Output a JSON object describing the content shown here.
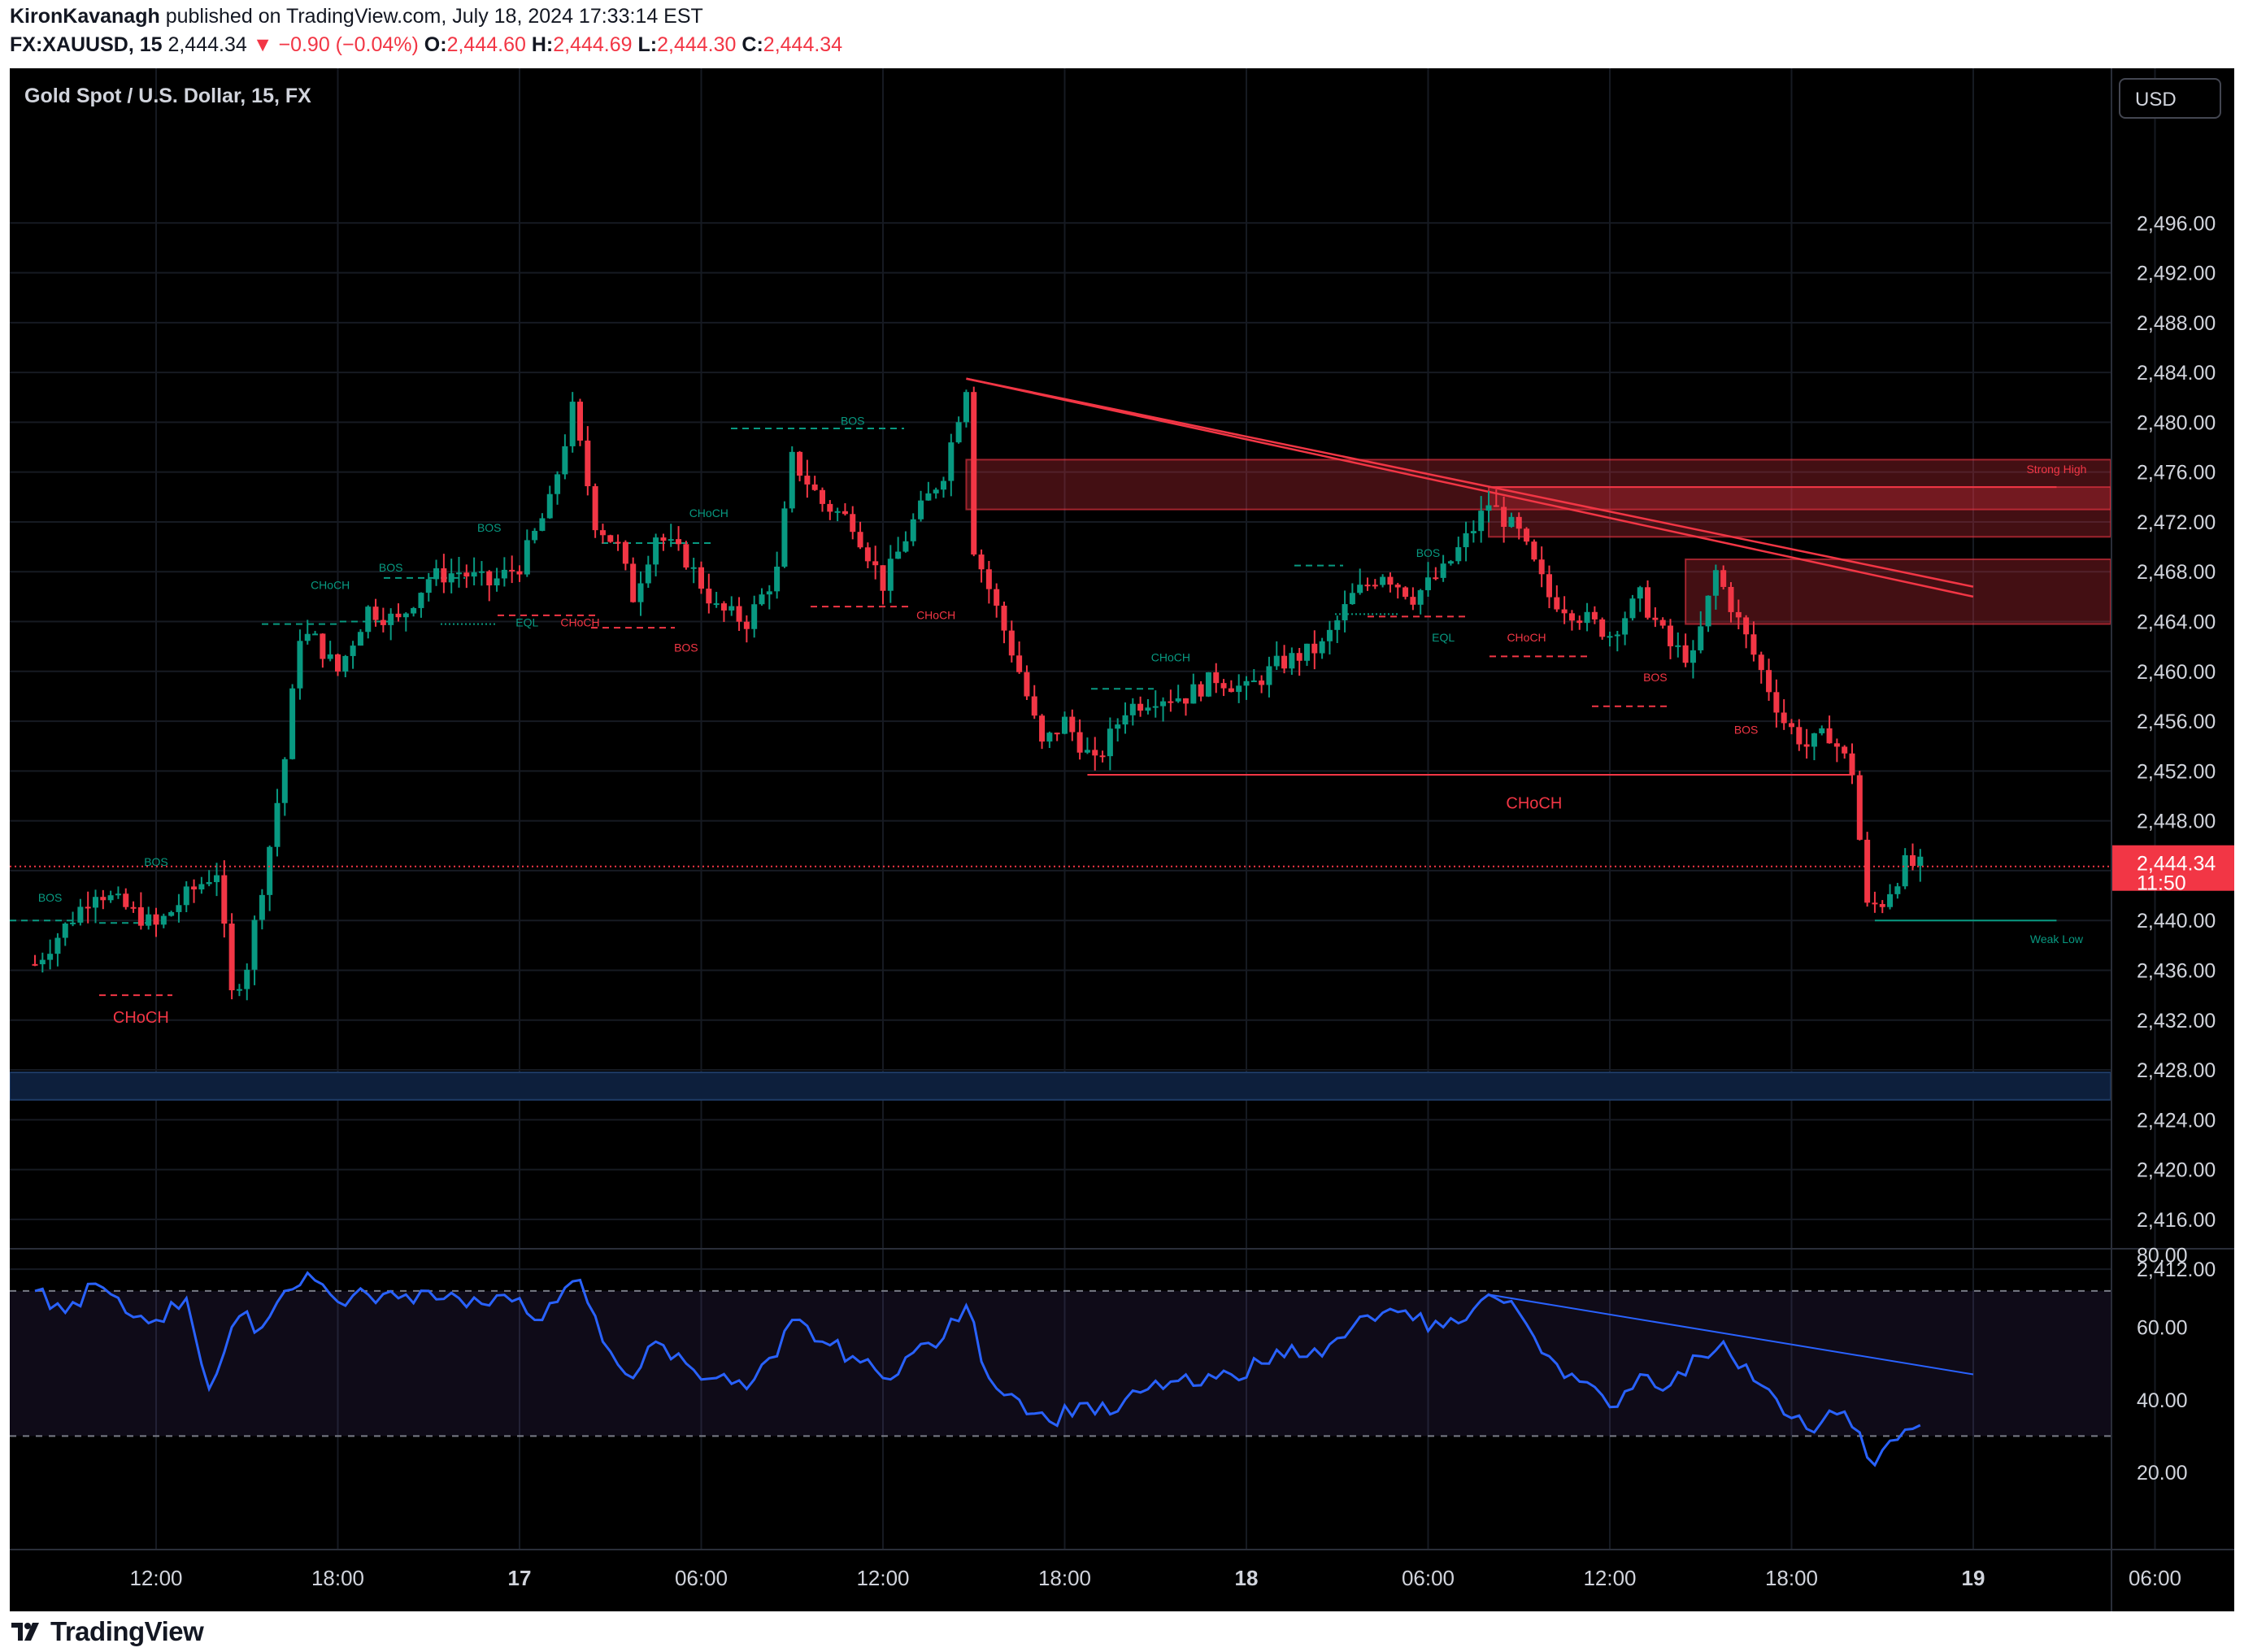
{
  "header": {
    "author": "KironKavanagh",
    "published_text": " published on TradingView.com, July 18, 2024 17:33:14 EST",
    "symbol_interval": "FX:XAUUSD, 15",
    "last_price": "2,444.34",
    "change_arrow": "▼",
    "change": "−0.90 (−0.04%)",
    "open_label": "O:",
    "open": "2,444.60",
    "high_label": "H:",
    "high": "2,444.69",
    "low_label": "L:",
    "low": "2,444.30",
    "close_label": "C:",
    "close": "2,444.34"
  },
  "chart": {
    "symbol_title": "Gold Spot / U.S. Dollar, 15, FX",
    "currency_button": "USD",
    "price_tag": "2,444.34",
    "countdown": "11:50"
  },
  "colors": {
    "up": "#089981",
    "down": "#f23645",
    "rsi_line": "#2962ff",
    "background": "#000000",
    "text": "#d1d4dc",
    "zone_red": "#f23645",
    "zone_blue": "#1e3a64",
    "rsi_band": "#7e57c2"
  },
  "footer": {
    "brand": "TradingView",
    "logo_icon": "tradingview-logo-icon"
  },
  "chart_data": [
    {
      "type": "candlestick",
      "title": "Gold Spot / U.S. Dollar, 15, FX",
      "x_tick_labels": [
        "12:00",
        "18:00",
        "17",
        "06:00",
        "12:00",
        "18:00",
        "18",
        "06:00",
        "12:00",
        "18:00",
        "19",
        "06:00"
      ],
      "y_tick_labels": [
        "2,412.00",
        "2,416.00",
        "2,420.00",
        "2,424.00",
        "2,428.00",
        "2,432.00",
        "2,436.00",
        "2,440.00",
        "2,444.00",
        "2,448.00",
        "2,452.00",
        "2,456.00",
        "2,460.00",
        "2,464.00",
        "2,468.00",
        "2,472.00",
        "2,476.00",
        "2,480.00",
        "2,484.00",
        "2,488.00",
        "2,492.00",
        "2,496.00"
      ],
      "ylim": [
        2409,
        2500
      ],
      "grid": true,
      "last_price": 2444.34,
      "price_path": [
        {
          "t": "2024-07-16 08:00",
          "p": 2436.5
        },
        {
          "t": "2024-07-16 09:00",
          "p": 2439.5
        },
        {
          "t": "2024-07-16 10:00",
          "p": 2442.5
        },
        {
          "t": "2024-07-16 11:00",
          "p": 2441.0
        },
        {
          "t": "2024-07-16 12:00",
          "p": 2439.5
        },
        {
          "t": "2024-07-16 13:00",
          "p": 2442.0
        },
        {
          "t": "2024-07-16 14:00",
          "p": 2444.0
        },
        {
          "t": "2024-07-16 14:30",
          "p": 2434.0
        },
        {
          "t": "2024-07-16 15:00",
          "p": 2436.5
        },
        {
          "t": "2024-07-16 15:45",
          "p": 2446.0
        },
        {
          "t": "2024-07-16 16:15",
          "p": 2453.0
        },
        {
          "t": "2024-07-16 16:45",
          "p": 2463.0
        },
        {
          "t": "2024-07-16 17:15",
          "p": 2462.5
        },
        {
          "t": "2024-07-16 18:00",
          "p": 2460.0
        },
        {
          "t": "2024-07-16 19:00",
          "p": 2465.0
        },
        {
          "t": "2024-07-16 20:00",
          "p": 2464.0
        },
        {
          "t": "2024-07-16 21:00",
          "p": 2467.5
        },
        {
          "t": "2024-07-16 22:00",
          "p": 2468.0
        },
        {
          "t": "2024-07-16 23:00",
          "p": 2467.0
        },
        {
          "t": "2024-07-17 00:00",
          "p": 2468.5
        },
        {
          "t": "2024-07-17 01:00",
          "p": 2473.5
        },
        {
          "t": "2024-07-17 01:45",
          "p": 2481.0
        },
        {
          "t": "2024-07-17 02:30",
          "p": 2472.0
        },
        {
          "t": "2024-07-17 03:15",
          "p": 2470.0
        },
        {
          "t": "2024-07-17 03:45",
          "p": 2466.0
        },
        {
          "t": "2024-07-17 04:30",
          "p": 2471.0
        },
        {
          "t": "2024-07-17 05:30",
          "p": 2469.0
        },
        {
          "t": "2024-07-17 06:30",
          "p": 2465.0
        },
        {
          "t": "2024-07-17 07:30",
          "p": 2464.0
        },
        {
          "t": "2024-07-17 08:30",
          "p": 2468.0
        },
        {
          "t": "2024-07-17 09:00",
          "p": 2477.0
        },
        {
          "t": "2024-07-17 10:00",
          "p": 2473.5
        },
        {
          "t": "2024-07-17 11:00",
          "p": 2472.0
        },
        {
          "t": "2024-07-17 12:00",
          "p": 2467.0
        },
        {
          "t": "2024-07-17 13:00",
          "p": 2472.0
        },
        {
          "t": "2024-07-17 14:00",
          "p": 2476.0
        },
        {
          "t": "2024-07-17 14:45",
          "p": 2483.0
        },
        {
          "t": "2024-07-17 15:00",
          "p": 2470.0
        },
        {
          "t": "2024-07-17 15:45",
          "p": 2465.0
        },
        {
          "t": "2024-07-17 16:30",
          "p": 2460.0
        },
        {
          "t": "2024-07-17 17:15",
          "p": 2454.0
        },
        {
          "t": "2024-07-17 18:00",
          "p": 2456.0
        },
        {
          "t": "2024-07-17 19:00",
          "p": 2452.5
        },
        {
          "t": "2024-07-17 20:00",
          "p": 2457.0
        },
        {
          "t": "2024-07-17 21:00",
          "p": 2458.0
        },
        {
          "t": "2024-07-17 22:00",
          "p": 2458.0
        },
        {
          "t": "2024-07-17 23:00",
          "p": 2459.5
        },
        {
          "t": "2024-07-18 00:00",
          "p": 2458.5
        },
        {
          "t": "2024-07-18 01:00",
          "p": 2460.5
        },
        {
          "t": "2024-07-18 02:30",
          "p": 2462.0
        },
        {
          "t": "2024-07-18 03:30",
          "p": 2466.0
        },
        {
          "t": "2024-07-18 04:30",
          "p": 2468.0
        },
        {
          "t": "2024-07-18 05:30",
          "p": 2466.0
        },
        {
          "t": "2024-07-18 06:30",
          "p": 2468.0
        },
        {
          "t": "2024-07-18 07:30",
          "p": 2471.5
        },
        {
          "t": "2024-07-18 08:00",
          "p": 2473.5
        },
        {
          "t": "2024-07-18 09:00",
          "p": 2471.0
        },
        {
          "t": "2024-07-18 10:00",
          "p": 2466.0
        },
        {
          "t": "2024-07-18 11:00",
          "p": 2464.5
        },
        {
          "t": "2024-07-18 12:00",
          "p": 2463.0
        },
        {
          "t": "2024-07-18 13:00",
          "p": 2466.0
        },
        {
          "t": "2024-07-18 14:00",
          "p": 2462.0
        },
        {
          "t": "2024-07-18 14:45",
          "p": 2461.0
        },
        {
          "t": "2024-07-18 15:30",
          "p": 2468.0
        },
        {
          "t": "2024-07-18 16:15",
          "p": 2464.0
        },
        {
          "t": "2024-07-18 17:00",
          "p": 2460.0
        },
        {
          "t": "2024-07-18 17:45",
          "p": 2456.0
        },
        {
          "t": "2024-07-18 18:30",
          "p": 2454.0
        },
        {
          "t": "2024-07-18 19:15",
          "p": 2455.0
        },
        {
          "t": "2024-07-18 20:00",
          "p": 2452.0
        },
        {
          "t": "2024-07-18 20:30",
          "p": 2441.0
        },
        {
          "t": "2024-07-18 21:00",
          "p": 2441.5
        },
        {
          "t": "2024-07-18 21:45",
          "p": 2444.5
        },
        {
          "t": "2024-07-18 22:15",
          "p": 2444.34
        }
      ],
      "annotations": [
        {
          "text": "BOS",
          "color": "#089981",
          "t": "2024-07-16 08:30",
          "p": 2441.5
        },
        {
          "text": "BOS",
          "color": "#089981",
          "t": "2024-07-16 12:00",
          "p": 2444.4
        },
        {
          "text": "CHoCH",
          "color": "#f23645",
          "t": "2024-07-16 11:30",
          "p": 2431.8
        },
        {
          "text": "CHoCH",
          "color": "#089981",
          "t": "2024-07-16 17:45",
          "p": 2466.6
        },
        {
          "text": "BOS",
          "color": "#089981",
          "t": "2024-07-16 19:45",
          "p": 2468.0
        },
        {
          "text": "BOS",
          "color": "#089981",
          "t": "2024-07-16 23:00",
          "p": 2471.2
        },
        {
          "text": "EQL",
          "color": "#089981",
          "t": "2024-07-17 00:15",
          "p": 2463.6
        },
        {
          "text": "CHoCH",
          "color": "#f23645",
          "t": "2024-07-17 02:00",
          "p": 2463.6
        },
        {
          "text": "BOS",
          "color": "#f23645",
          "t": "2024-07-17 05:30",
          "p": 2461.6
        },
        {
          "text": "CHoCH",
          "color": "#089981",
          "t": "2024-07-17 06:15",
          "p": 2472.4
        },
        {
          "text": "BOS",
          "color": "#089981",
          "t": "2024-07-17 11:00",
          "p": 2479.8
        },
        {
          "text": "CHoCH",
          "color": "#f23645",
          "t": "2024-07-17 13:45",
          "p": 2464.2
        },
        {
          "text": "CHoCH",
          "color": "#089981",
          "t": "2024-07-17 21:30",
          "p": 2460.8
        },
        {
          "text": "BOS",
          "color": "#089981",
          "t": "2024-07-18 06:00",
          "p": 2469.2
        },
        {
          "text": "EQL",
          "color": "#089981",
          "t": "2024-07-18 06:30",
          "p": 2462.4
        },
        {
          "text": "CHoCH",
          "color": "#f23645",
          "t": "2024-07-18 09:15",
          "p": 2462.4
        },
        {
          "text": "BOS",
          "color": "#f23645",
          "t": "2024-07-18 13:30",
          "p": 2459.2
        },
        {
          "text": "BOS",
          "color": "#f23645",
          "t": "2024-07-18 16:30",
          "p": 2455.0
        },
        {
          "text": "CHoCH",
          "color": "#f23645",
          "t": "2024-07-18 09:30",
          "p": 2449.0
        },
        {
          "text": "Strong High",
          "color": "#f23645",
          "t": "2024-07-19 02:45",
          "p": 2475.9
        },
        {
          "text": "Weak Low",
          "color": "#089981",
          "t": "2024-07-19 02:45",
          "p": 2438.2
        }
      ],
      "zones": [
        {
          "kind": "supply",
          "from": "2024-07-17 14:45",
          "to": "2024-07-19 10:00",
          "low": 2473.0,
          "high": 2477.0
        },
        {
          "kind": "supply",
          "from": "2024-07-18 08:00",
          "to": "2024-07-19 10:00",
          "low": 2470.8,
          "high": 2474.8
        },
        {
          "kind": "supply",
          "from": "2024-07-18 14:30",
          "to": "2024-07-19 10:00",
          "low": 2463.8,
          "high": 2469.0
        },
        {
          "kind": "demand",
          "from": "2024-07-16 08:00",
          "to": "2024-07-19 10:00",
          "low": 2425.6,
          "high": 2427.8
        }
      ],
      "trendlines": [
        {
          "from_t": "2024-07-17 14:45",
          "from_p": 2483.5,
          "to_t": "2024-07-19 00:00",
          "to_p": 2466.0
        },
        {
          "from_t": "2024-07-17 14:45",
          "from_p": 2483.5,
          "to_t": "2024-07-19 00:00",
          "to_p": 2466.8
        }
      ],
      "levels": [
        {
          "t1": "2024-07-17 18:45",
          "t2": "2024-07-18 20:00",
          "p": 2451.7,
          "color": "#f23645"
        },
        {
          "t1": "2024-07-18 20:45",
          "t2": "2024-07-19 02:45",
          "p": 2440.0,
          "color": "#089981"
        },
        {
          "t1": "2024-07-18 08:00",
          "t2": "2024-07-19 02:45",
          "p": 2474.8,
          "color": "#f23645"
        }
      ]
    },
    {
      "type": "line",
      "title": "RSI",
      "y_tick_labels": [
        "20.00",
        "40.00",
        "60.00",
        "80.00"
      ],
      "ylim": [
        16,
        88
      ],
      "band": [
        30,
        70
      ],
      "series": [
        {
          "values": [
            {
              "t": "2024-07-16 08:00",
              "v": 70
            },
            {
              "t": "2024-07-16 09:00",
              "v": 64
            },
            {
              "t": "2024-07-16 10:00",
              "v": 72
            },
            {
              "t": "2024-07-16 11:00",
              "v": 64
            },
            {
              "t": "2024-07-16 12:00",
              "v": 62
            },
            {
              "t": "2024-07-16 13:00",
              "v": 68
            },
            {
              "t": "2024-07-16 13:45",
              "v": 43
            },
            {
              "t": "2024-07-16 14:45",
              "v": 63
            },
            {
              "t": "2024-07-16 15:30",
              "v": 60
            },
            {
              "t": "2024-07-16 16:15",
              "v": 70
            },
            {
              "t": "2024-07-16 17:00",
              "v": 75
            },
            {
              "t": "2024-07-16 18:00",
              "v": 67
            },
            {
              "t": "2024-07-16 19:00",
              "v": 69
            },
            {
              "t": "2024-07-16 20:00",
              "v": 68
            },
            {
              "t": "2024-07-16 21:00",
              "v": 70
            },
            {
              "t": "2024-07-16 22:00",
              "v": 68
            },
            {
              "t": "2024-07-16 23:00",
              "v": 66
            },
            {
              "t": "2024-07-17 00:00",
              "v": 68
            },
            {
              "t": "2024-07-17 00:45",
              "v": 62
            },
            {
              "t": "2024-07-17 01:15",
              "v": 67
            },
            {
              "t": "2024-07-17 02:00",
              "v": 73
            },
            {
              "t": "2024-07-17 02:45",
              "v": 56
            },
            {
              "t": "2024-07-17 03:45",
              "v": 46
            },
            {
              "t": "2024-07-17 04:30",
              "v": 56
            },
            {
              "t": "2024-07-17 05:30",
              "v": 50
            },
            {
              "t": "2024-07-17 06:30",
              "v": 46
            },
            {
              "t": "2024-07-17 07:30",
              "v": 43
            },
            {
              "t": "2024-07-17 08:30",
              "v": 52
            },
            {
              "t": "2024-07-17 09:00",
              "v": 62
            },
            {
              "t": "2024-07-17 10:00",
              "v": 56
            },
            {
              "t": "2024-07-17 11:00",
              "v": 52
            },
            {
              "t": "2024-07-17 12:00",
              "v": 46
            },
            {
              "t": "2024-07-17 13:00",
              "v": 53
            },
            {
              "t": "2024-07-17 14:00",
              "v": 57
            },
            {
              "t": "2024-07-17 14:45",
              "v": 66
            },
            {
              "t": "2024-07-17 15:30",
              "v": 46
            },
            {
              "t": "2024-07-17 16:30",
              "v": 40
            },
            {
              "t": "2024-07-17 17:30",
              "v": 34
            },
            {
              "t": "2024-07-17 18:30",
              "v": 39
            },
            {
              "t": "2024-07-17 19:30",
              "v": 36
            },
            {
              "t": "2024-07-17 20:30",
              "v": 42
            },
            {
              "t": "2024-07-17 21:30",
              "v": 45
            },
            {
              "t": "2024-07-17 22:30",
              "v": 44
            },
            {
              "t": "2024-07-17 23:30",
              "v": 47
            },
            {
              "t": "2024-07-18 00:30",
              "v": 50
            },
            {
              "t": "2024-07-18 01:30",
              "v": 55
            },
            {
              "t": "2024-07-18 02:30",
              "v": 52
            },
            {
              "t": "2024-07-18 03:30",
              "v": 60
            },
            {
              "t": "2024-07-18 04:30",
              "v": 64
            },
            {
              "t": "2024-07-18 05:30",
              "v": 62
            },
            {
              "t": "2024-07-18 06:30",
              "v": 60
            },
            {
              "t": "2024-07-18 07:30",
              "v": 65
            },
            {
              "t": "2024-07-18 08:00",
              "v": 69
            },
            {
              "t": "2024-07-18 09:00",
              "v": 64
            },
            {
              "t": "2024-07-18 10:00",
              "v": 52
            },
            {
              "t": "2024-07-18 11:00",
              "v": 45
            },
            {
              "t": "2024-07-18 12:00",
              "v": 38
            },
            {
              "t": "2024-07-18 13:00",
              "v": 47
            },
            {
              "t": "2024-07-18 14:00",
              "v": 44
            },
            {
              "t": "2024-07-18 15:00",
              "v": 52
            },
            {
              "t": "2024-07-18 15:45",
              "v": 56
            },
            {
              "t": "2024-07-18 17:00",
              "v": 44
            },
            {
              "t": "2024-07-18 17:45",
              "v": 36
            },
            {
              "t": "2024-07-18 18:30",
              "v": 32
            },
            {
              "t": "2024-07-18 19:30",
              "v": 36
            },
            {
              "t": "2024-07-18 20:15",
              "v": 31
            },
            {
              "t": "2024-07-18 20:45",
              "v": 22
            },
            {
              "t": "2024-07-18 21:30",
              "v": 29
            },
            {
              "t": "2024-07-18 22:00",
              "v": 32
            },
            {
              "t": "2024-07-18 22:15",
              "v": 33
            }
          ]
        }
      ],
      "trendline": {
        "from_t": "2024-07-18 08:00",
        "from_v": 69,
        "to_t": "2024-07-19 00:00",
        "to_v": 47
      }
    }
  ]
}
